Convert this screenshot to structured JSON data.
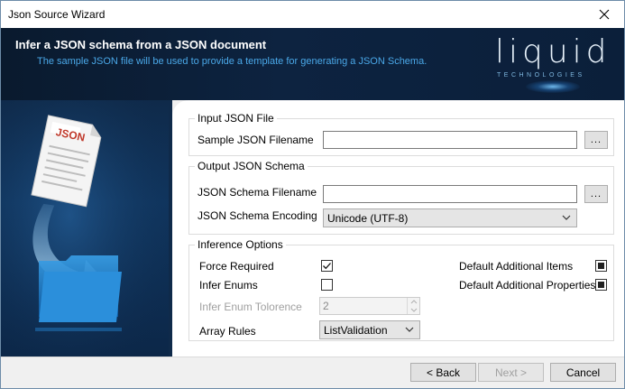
{
  "window": {
    "title": "Json Source Wizard"
  },
  "banner": {
    "heading": "Infer a JSON schema from a JSON document",
    "subheading": "The sample JSON file will be used to provide a template for generating a JSON Schema.",
    "logo_word": "liquid",
    "logo_tagline": "TECHNOLOGIES"
  },
  "side": {
    "doc_label": "JSON"
  },
  "input_group": {
    "title": "Input JSON File",
    "sample_label": "Sample JSON Filename",
    "sample_value": "",
    "browse_label": "..."
  },
  "output_group": {
    "title": "Output JSON Schema",
    "schema_label": "JSON Schema Filename",
    "schema_value": "",
    "browse_label": "...",
    "encoding_label": "JSON Schema Encoding",
    "encoding_value": "Unicode (UTF-8)"
  },
  "inference_group": {
    "title": "Inference Options",
    "force_required_label": "Force Required",
    "force_required_checked": true,
    "infer_enums_label": "Infer Enums",
    "infer_enums_checked": false,
    "tolerance_label": "Infer Enum Tolorence",
    "tolerance_value": "2",
    "array_rules_label": "Array Rules",
    "array_rules_value": "ListValidation",
    "default_items_label": "Default Additional Items",
    "default_items_state": "indeterminate",
    "default_props_label": "Default Additional Properties",
    "default_props_state": "indeterminate"
  },
  "footer": {
    "back_label": "< Back",
    "next_label": "Next >",
    "cancel_label": "Cancel"
  },
  "colors": {
    "banner_bg": "#0d2340",
    "subheading": "#4aa8e8",
    "side_bg": "#10355e"
  }
}
